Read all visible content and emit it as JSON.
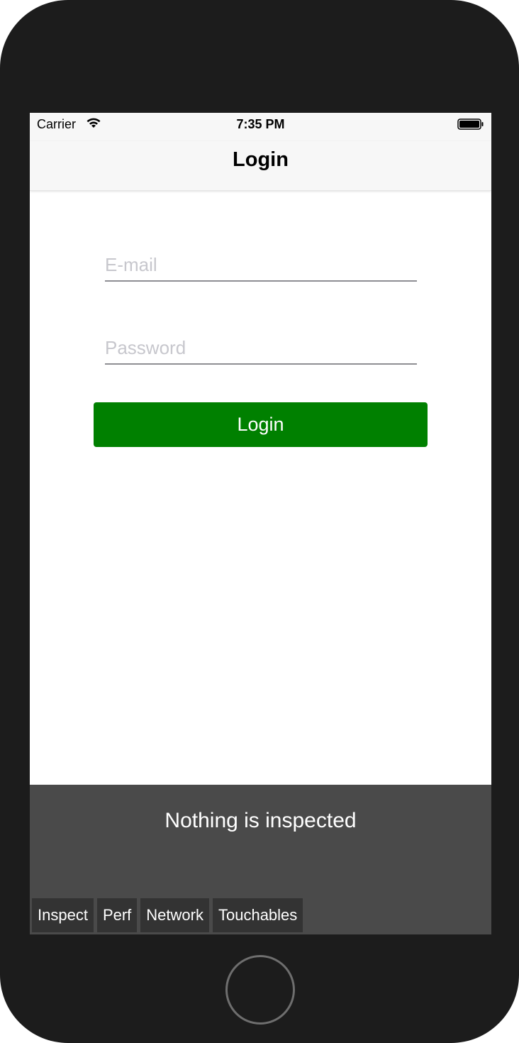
{
  "status_bar": {
    "carrier": "Carrier",
    "time": "7:35 PM",
    "wifi_icon": "wifi-icon",
    "battery_icon": "battery-full-icon"
  },
  "nav": {
    "title": "Login"
  },
  "form": {
    "email": {
      "placeholder": "E-mail",
      "value": ""
    },
    "password": {
      "placeholder": "Password",
      "value": ""
    },
    "login_label": "Login",
    "button_color": "#008000"
  },
  "inspector": {
    "message": "Nothing is inspected",
    "tabs": [
      "Inspect",
      "Perf",
      "Network",
      "Touchables"
    ],
    "background": "#4a4a4a"
  },
  "device": {
    "home_button_icon": "home-button-circle"
  }
}
